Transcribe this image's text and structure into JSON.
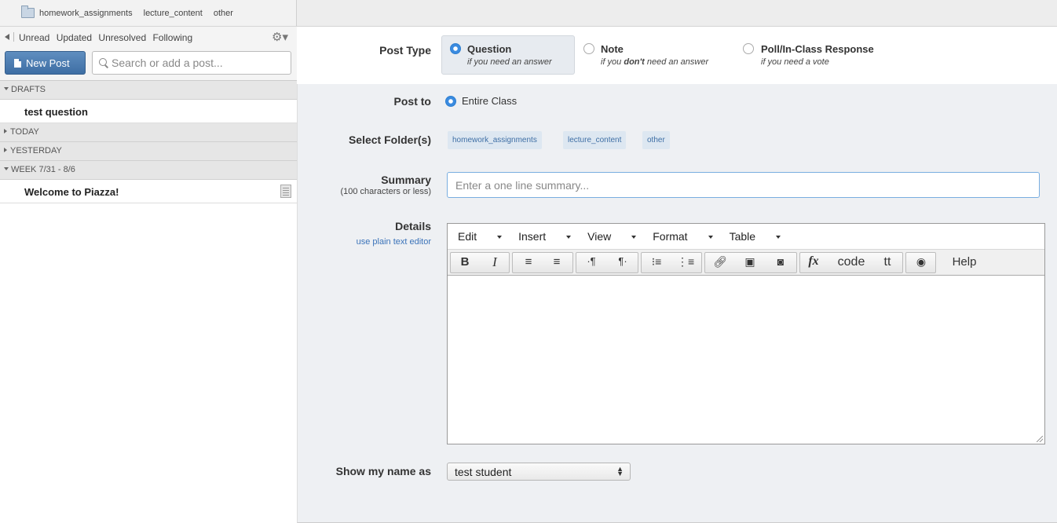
{
  "top_folders": [
    "homework_assignments",
    "lecture_content",
    "other"
  ],
  "filters": [
    "Unread",
    "Updated",
    "Unresolved",
    "Following"
  ],
  "new_post_label": "New Post",
  "search_placeholder": "Search or add a post...",
  "feed": {
    "drafts_header": "DRAFTS",
    "draft_item": "test question",
    "today_header": "TODAY",
    "yesterday_header": "YESTERDAY",
    "week_header": "WEEK 7/31 - 8/6",
    "week_item": "Welcome to Piazza!"
  },
  "form": {
    "post_type_label": "Post Type",
    "post_types": [
      {
        "title": "Question",
        "sub": "if you need an answer"
      },
      {
        "title": "Note",
        "sub_pre": "if you ",
        "sub_bold": "don't",
        "sub_post": " need an answer"
      },
      {
        "title": "Poll/In-Class Response",
        "sub": "if you need a vote"
      }
    ],
    "post_to_label": "Post to",
    "post_to_value": "Entire Class",
    "folders_label": "Select Folder(s)",
    "folders": [
      "homework_assignments",
      "lecture_content",
      "other"
    ],
    "summary_label": "Summary",
    "summary_sublabel": "(100 characters or less)",
    "summary_placeholder": "Enter a one line summary...",
    "details_label": "Details",
    "plain_text_link": "use plain text editor",
    "editor_menus": [
      "Edit",
      "Insert",
      "View",
      "Format",
      "Table"
    ],
    "toolbar": {
      "bold": "B",
      "italic": "I",
      "code": "code",
      "tt": "tt",
      "help": "Help"
    },
    "show_name_label": "Show my name as",
    "show_name_value": "test student"
  },
  "colors": {
    "accent": "#3e6ea4",
    "tag_bg": "#dde7f1",
    "form_bg": "#eef0f3"
  }
}
